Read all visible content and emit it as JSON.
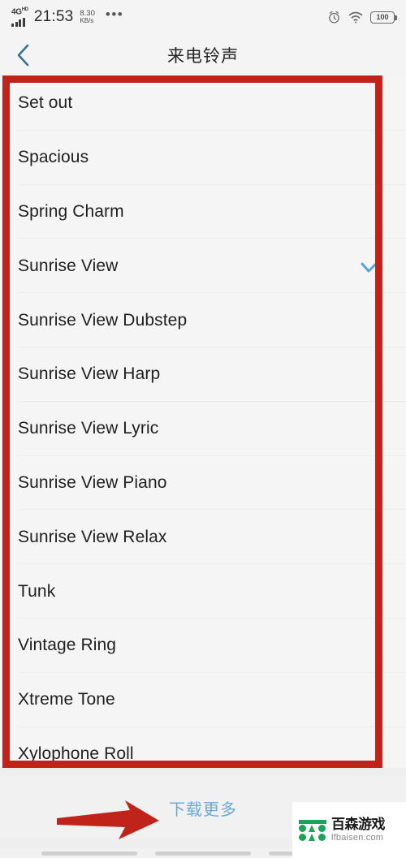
{
  "status_bar": {
    "network_type": "4G",
    "network_suffix": "HD",
    "time": "21:53",
    "speed_value": "8.30",
    "speed_unit": "KB/s",
    "overflow_icon": "•••",
    "alarm_icon": "alarm-clock-icon",
    "wifi_icon": "wifi-icon",
    "battery_level": "100"
  },
  "header": {
    "back_icon": "chevron-left-icon",
    "title": "来电铃声"
  },
  "ringtone_list": {
    "items": [
      {
        "label": "Set out",
        "selected": false
      },
      {
        "label": "Spacious",
        "selected": false
      },
      {
        "label": "Spring Charm",
        "selected": false
      },
      {
        "label": "Sunrise View",
        "selected": true
      },
      {
        "label": "Sunrise View Dubstep",
        "selected": false
      },
      {
        "label": "Sunrise View Harp",
        "selected": false
      },
      {
        "label": "Sunrise View Lyric",
        "selected": false
      },
      {
        "label": "Sunrise View Piano",
        "selected": false
      },
      {
        "label": "Sunrise View Relax",
        "selected": false
      },
      {
        "label": "Tunk",
        "selected": false
      },
      {
        "label": "Vintage Ring",
        "selected": false
      },
      {
        "label": "Xtreme Tone",
        "selected": false
      },
      {
        "label": "Xylophone Roll",
        "selected": false
      }
    ],
    "check_icon": "checkmark-icon",
    "check_color": "#55a4de"
  },
  "footer": {
    "download_more_label": "下载更多",
    "link_color": "#6aa9d8"
  },
  "annotations": {
    "rect_color": "#c0231a",
    "arrow_color": "#c0231a",
    "arrow_icon": "arrow-right-icon"
  },
  "watermark": {
    "brand_cn": "百森游戏",
    "brand_url": "lfbaisen.com",
    "brand_color": "#18a558"
  }
}
